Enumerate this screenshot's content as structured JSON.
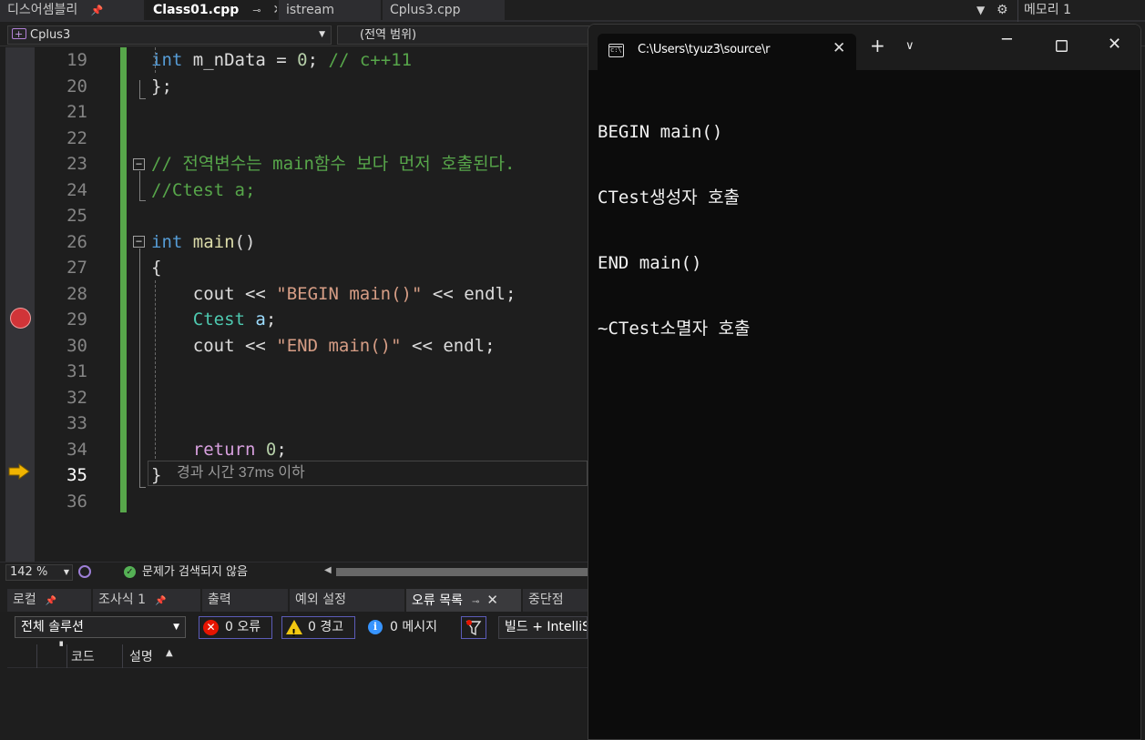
{
  "tabs": {
    "disassembly": "디스어셈블리",
    "class01": "Class01.cpp",
    "istream": "istream",
    "cplus3": "Cplus3.cpp",
    "memory": "메모리 1"
  },
  "nav": {
    "project": "Cplus3",
    "scope": "(전역 범위)"
  },
  "editor": {
    "lines": [
      {
        "no": "19",
        "tokens": [
          [
            "kw",
            "int"
          ],
          [
            "pl",
            " m_nData = "
          ],
          [
            "num",
            "0"
          ],
          [
            "pl",
            "; "
          ],
          [
            "cmt",
            "// c++11"
          ]
        ]
      },
      {
        "no": "20",
        "tokens": [
          [
            "pl",
            "};"
          ]
        ]
      },
      {
        "no": "21",
        "tokens": []
      },
      {
        "no": "22",
        "tokens": []
      },
      {
        "no": "23",
        "tokens": [
          [
            "cmt",
            "// 전역변수는 main함수 보다 먼저 호출된다."
          ]
        ]
      },
      {
        "no": "24",
        "tokens": [
          [
            "cmt",
            "//Ctest a;"
          ]
        ]
      },
      {
        "no": "25",
        "tokens": []
      },
      {
        "no": "26",
        "tokens": [
          [
            "kw",
            "int"
          ],
          [
            "pl",
            " "
          ],
          [
            "fn",
            "main"
          ],
          [
            "pl",
            "()"
          ]
        ]
      },
      {
        "no": "27",
        "tokens": [
          [
            "pl",
            "{"
          ]
        ]
      },
      {
        "no": "28",
        "tokens": [
          [
            "pl",
            "    cout << "
          ],
          [
            "str",
            "\"BEGIN main()\""
          ],
          [
            "pl",
            " << endl;"
          ]
        ]
      },
      {
        "no": "29",
        "tokens": [
          [
            "pl",
            "    "
          ],
          [
            "type",
            "Ctest"
          ],
          [
            "pl",
            " "
          ],
          [
            "var",
            "a"
          ],
          [
            "pl",
            ";"
          ]
        ]
      },
      {
        "no": "30",
        "tokens": [
          [
            "pl",
            "    cout << "
          ],
          [
            "str",
            "\"END main()\""
          ],
          [
            "pl",
            " << endl;"
          ]
        ]
      },
      {
        "no": "31",
        "tokens": []
      },
      {
        "no": "32",
        "tokens": []
      },
      {
        "no": "33",
        "tokens": []
      },
      {
        "no": "34",
        "tokens": [
          [
            "pl",
            "    "
          ],
          [
            "kw2",
            "return"
          ],
          [
            "pl",
            " "
          ],
          [
            "num",
            "0"
          ],
          [
            "pl",
            ";"
          ]
        ]
      },
      {
        "no": "35",
        "tokens": [
          [
            "pl",
            "}"
          ]
        ]
      },
      {
        "no": "36",
        "tokens": []
      }
    ],
    "current_line": "35",
    "breakpoint_line": "29",
    "elapsed_hint": "경과 시간 37ms 이하"
  },
  "status": {
    "zoom": "142 %",
    "issues": "문제가 검색되지 않음"
  },
  "tool_tabs": {
    "locals": "로컬",
    "watch": "조사식 1",
    "output": "출력",
    "exceptions": "예외 설정",
    "error_list": "오류 목록",
    "breakpoints": "중단점"
  },
  "error_list": {
    "scope": "전체 솔루션",
    "errors": "0 오류",
    "warnings": "0 경고",
    "messages": "0 메시지",
    "build_filter": "빌드 + IntelliSense",
    "col_code": "코드",
    "col_desc": "설명"
  },
  "console": {
    "tab_title": "C:\\Users\\tyuz3\\source\\r",
    "output": [
      "BEGIN main()",
      "CTest생성자 호출",
      "END main()",
      "~CTest소멸자 호출"
    ]
  },
  "colors": {
    "change_bar": "#57a64a",
    "breakpoint": "#d13438",
    "current_arrow": "#f0b400"
  }
}
